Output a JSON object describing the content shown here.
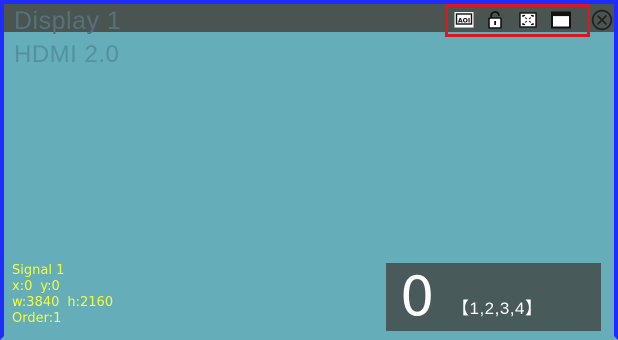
{
  "display": {
    "title": "Display 1",
    "interface": "HDMI 2.0"
  },
  "toolbar": {
    "items": [
      {
        "icon": "aoi-icon",
        "label": "AOI"
      },
      {
        "icon": "unlock-icon"
      },
      {
        "icon": "fullscreen-icon"
      },
      {
        "icon": "window-icon"
      }
    ],
    "close_icon": "close-icon",
    "highlight_color": "#d51a22"
  },
  "signal": {
    "name": "Signal 1",
    "x": "x:0",
    "y": "y:0",
    "w": "w:3840",
    "h": "h:2160",
    "order": "Order:1"
  },
  "badge": {
    "number": "0",
    "range": "【1,2,3,4】"
  },
  "colors": {
    "canvas": "#65adb9",
    "border": "#1f2cff",
    "title_bar": "#4a5451",
    "signal_text": "#f3ff3d",
    "badge_background": "#485a59"
  }
}
